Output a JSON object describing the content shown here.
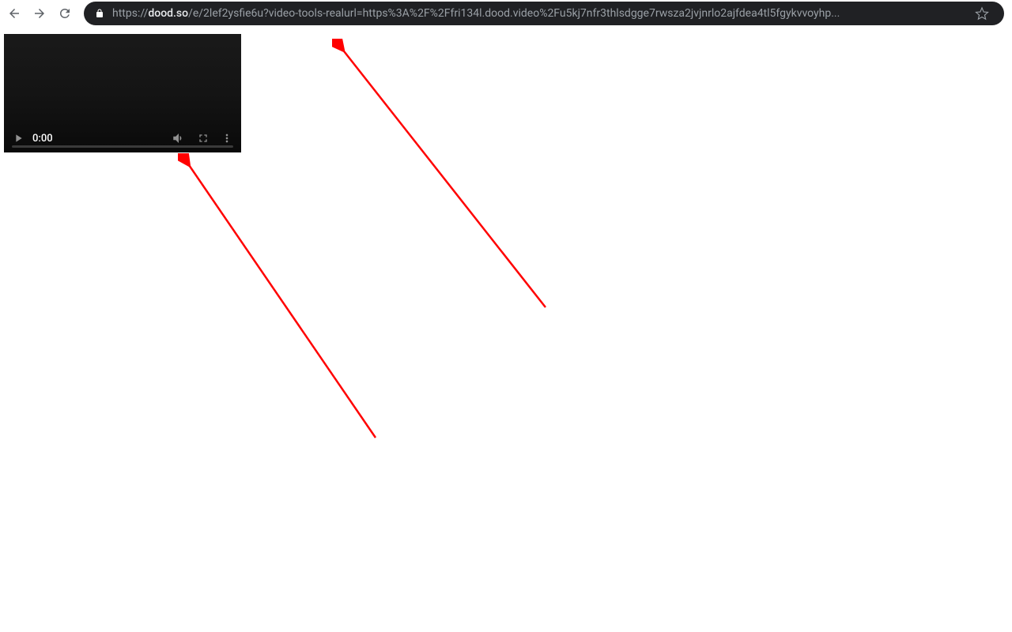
{
  "url": {
    "scheme": "https://",
    "domain": "dood.so",
    "path": "/e/2lef2ysfie6u?video-tools-realurl=https%3A%2F%2Ffri134l.dood.video%2Fu5kj7nfr3thlsdgge7rwsza2jvjnrlo2ajfdea4tl5fgykvvoyhp..."
  },
  "video": {
    "time": "0:00"
  },
  "annotations": {
    "arrow_color": "#ff0000"
  }
}
